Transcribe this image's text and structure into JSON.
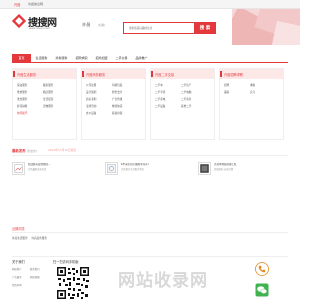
{
  "topbar": {
    "city": "许昌",
    "site": "许昌信息网"
  },
  "header": {
    "logo_text": "搜搜网",
    "logo_url": "www.dosoo.com",
    "city": "许昌",
    "city_switch": "[切换]",
    "search_placeholder": "搜索您感兴趣的信息",
    "search_button": "搜 索"
  },
  "nav": {
    "items": [
      {
        "label": "首页",
        "active": true
      },
      {
        "label": "生活服务",
        "active": false
      },
      {
        "label": "商务服务",
        "active": false
      },
      {
        "label": "招聘求职",
        "active": false
      },
      {
        "label": "招商加盟",
        "active": false
      },
      {
        "label": "二手交易",
        "active": false
      },
      {
        "label": "品牌推广",
        "active": false
      }
    ]
  },
  "panels": [
    {
      "title": "许昌生活服务",
      "links": [
        "家政服务",
        "搬家服务",
        "维修服务",
        "婚庆服务",
        "洗衣服务",
        "生活配送",
        "鲜花绿植",
        "宠物服务",
        "休闲娱乐"
      ]
    },
    {
      "title": "许昌商务服务",
      "links": [
        "公司注册",
        "印刷包装",
        "设计策划",
        "财务会计",
        "商标专利",
        "广告传媒",
        "法律咨询",
        "物流快递",
        "办公设备",
        "投资担保"
      ]
    },
    {
      "title": "许昌二手交易",
      "links": [
        "二手车",
        "二手房产",
        "二手手机",
        "二手电脑",
        "二手家电",
        "二手家具",
        "二手设备",
        "其他二手"
      ]
    },
    {
      "title": "许昌招聘求职",
      "links": [
        "招聘",
        "求职",
        "兼职",
        "实习"
      ]
    }
  ],
  "featured": {
    "title": "最新发布",
    "subtitle": "[新出炉]",
    "date": "2022年07月10日更新",
    "cards": [
      {
        "title": "新冠肺炎疫情期间,..",
        "desc": "许昌最新发布信息"
      },
      {
        "title": "6平米空间大概能干什么?",
        "desc": "许昌相关生活服务资讯"
      },
      {
        "title": "许昌本地装修施工队",
        "desc": "优质服务,价格合理"
      }
    ]
  },
  "recent": {
    "title": "近期浏览",
    "links": [
      "许昌生活服务",
      "许昌商务服务"
    ]
  },
  "footer": {
    "about_title": "关于我们",
    "about_links": [
      "网站简介",
      "联系我们",
      "广告服务",
      "网站地图",
      "免责声明"
    ],
    "follow_title": "扫一扫访问手机版",
    "watermark": "网站收录网"
  }
}
